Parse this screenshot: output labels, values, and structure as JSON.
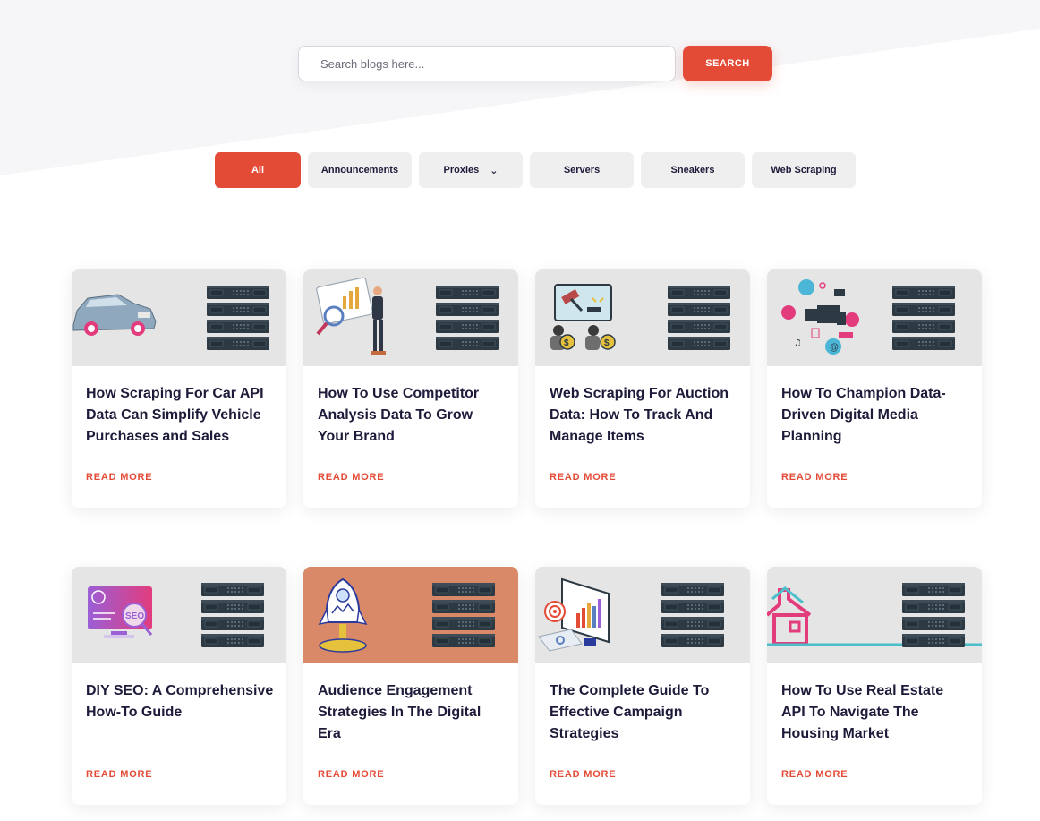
{
  "search": {
    "placeholder": "Search blogs here...",
    "button_label": "SEARCH"
  },
  "filters": [
    {
      "label": "All",
      "active": true
    },
    {
      "label": "Announcements"
    },
    {
      "label": "Proxies",
      "has_dropdown": true
    },
    {
      "label": "Servers"
    },
    {
      "label": "Sneakers"
    },
    {
      "label": "Web Scraping"
    }
  ],
  "colors": {
    "accent": "#e34b37",
    "chip_bg": "#efefef",
    "thumb_bg": "#e5e5e5",
    "thumb_orange": "#d98868",
    "title": "#1d1b3a"
  },
  "posts": [
    {
      "title": "How Scraping For Car API Data Can Simplify Vehicle Purchases and Sales",
      "read_more": "READ MORE",
      "illustration": "car-icon"
    },
    {
      "title": "How To Use Competitor Analysis Data To Grow Your Brand",
      "read_more": "READ MORE",
      "illustration": "analyst-presentation-icon"
    },
    {
      "title": "Web Scraping For Auction Data: How To Track And Manage Items",
      "read_more": "READ MORE",
      "illustration": "auction-gavel-icon"
    },
    {
      "title": "How To Champion Data-Driven Digital Media Planning",
      "read_more": "READ MORE",
      "illustration": "digital-media-icon"
    },
    {
      "title": "DIY SEO: A Comprehensive How-To Guide",
      "read_more": "READ MORE",
      "illustration": "seo-monitor-icon"
    },
    {
      "title": "Audience Engagement Strategies In The Digital Era",
      "read_more": "READ MORE",
      "illustration": "rocket-icon"
    },
    {
      "title": "The Complete Guide To Effective Campaign Strategies",
      "read_more": "READ MORE",
      "illustration": "campaign-target-icon"
    },
    {
      "title": "How To Use Real Estate API To Navigate The Housing Market",
      "read_more": "READ MORE",
      "illustration": "house-icon"
    }
  ]
}
